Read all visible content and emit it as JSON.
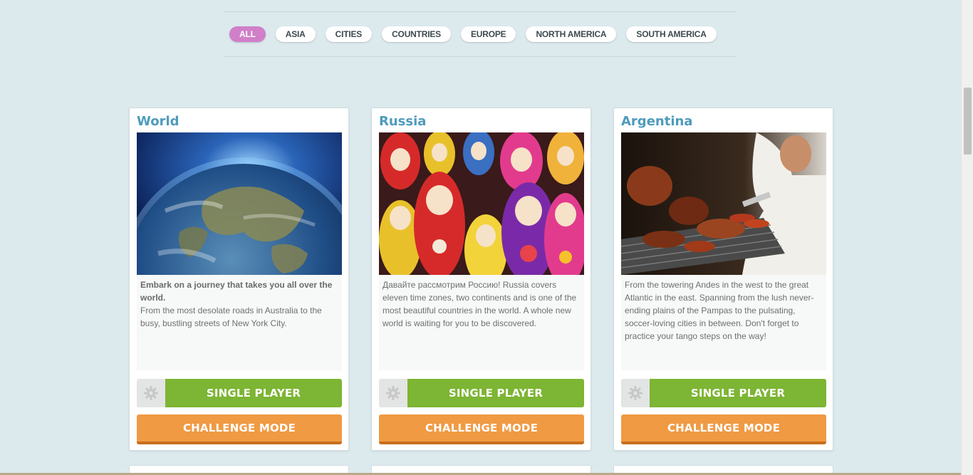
{
  "filters": {
    "items": [
      "ALL",
      "ASIA",
      "CITIES",
      "COUNTRIES",
      "EUROPE",
      "NORTH AMERICA",
      "SOUTH AMERICA"
    ],
    "active": "ALL",
    "active_color": "#d17fc9"
  },
  "cards": [
    {
      "title": "World",
      "image": "earth-from-space-image",
      "desc_lead": "Embark on a journey that takes you all over the world.",
      "desc": "From the most desolate roads in Australia to the busy, bustling streets of New York City.",
      "settings_icon": "gear-icon",
      "single_label": "SINGLE PLAYER",
      "challenge_label": "CHALLENGE MODE"
    },
    {
      "title": "Russia",
      "image": "matryoshka-dolls-image",
      "desc_lead": "",
      "desc": "Давайте рассмотрим Россию! Russia covers eleven time zones, two continents and is one of the most beautiful countries in the world. A whole new world is waiting for you to be discovered.",
      "settings_icon": "gear-icon",
      "single_label": "SINGLE PLAYER",
      "challenge_label": "CHALLENGE MODE"
    },
    {
      "title": "Argentina",
      "image": "asado-grill-image",
      "desc_lead": "",
      "desc": "From the towering Andes in the west to the great Atlantic in the east. Spanning from the lush never-ending plains of the Pampas to the pulsating, soccer-loving cities in between. Don't forget to practice your tango steps on the way!",
      "settings_icon": "gear-icon",
      "single_label": "SINGLE PLAYER",
      "challenge_label": "CHALLENGE MODE"
    }
  ],
  "colors": {
    "background": "#dceaee",
    "title": "#4e9bbd",
    "single_player": "#7db534",
    "challenge": "#f09a43"
  }
}
